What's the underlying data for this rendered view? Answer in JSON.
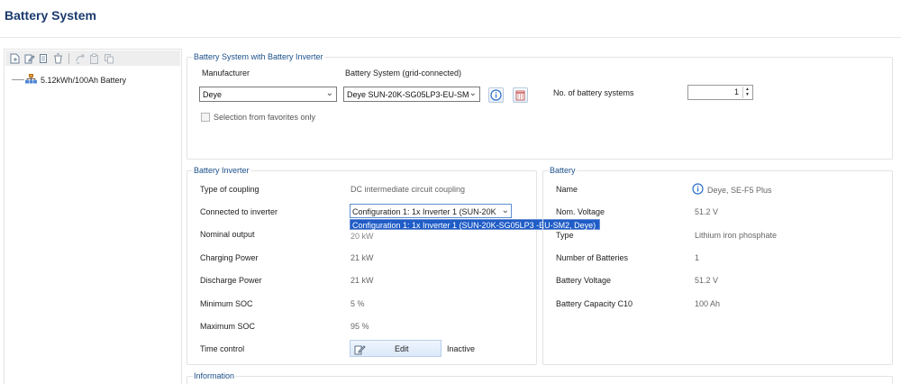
{
  "page": {
    "title": "Battery System"
  },
  "tree": {
    "toolbar_icons": [
      "new-icon",
      "edit-icon",
      "copy-icon",
      "delete-icon",
      "connect-icon",
      "paste-icon",
      "duplicate-icon"
    ],
    "items": [
      {
        "label": "5.12kWh/100Ah Battery",
        "icon": "battery-network-icon"
      }
    ]
  },
  "system_group": {
    "title": "Battery System with Battery Inverter",
    "manufacturer_label": "Manufacturer",
    "manufacturer_value": "Deye",
    "system_label": "Battery System (grid-connected)",
    "system_value": "Deye SUN-20K-SG05LP3-EU-SM2",
    "favorites_label": "Selection from favorites only",
    "count_label": "No. of battery systems",
    "count_value": "1"
  },
  "inverter_group": {
    "title": "Battery Inverter",
    "rows": [
      {
        "label": "Type of coupling",
        "value": "DC intermediate circuit coupling"
      },
      {
        "label": "Connected to inverter",
        "value": "Configuration 1: 1x Inverter 1 (SUN-20K"
      },
      {
        "label": "Nominal output",
        "value": "20 kW"
      },
      {
        "label": "Charging Power",
        "value": "21 kW"
      },
      {
        "label": "Discharge Power",
        "value": "21 kW"
      },
      {
        "label": "Minimum SOC",
        "value": "5 %"
      },
      {
        "label": "Maximum SOC",
        "value": "95 %"
      },
      {
        "label": "Time control",
        "value": "Inactive"
      }
    ],
    "dropdown_option": "Configuration 1: 1x Inverter 1 (SUN-20K-SG05LP3 -EU-SM2, Deye)",
    "edit_label": "Edit"
  },
  "battery_group": {
    "title": "Battery",
    "rows": [
      {
        "label": "Name",
        "value": "Deye, SE-F5 Plus"
      },
      {
        "label": "Nom. Voltage",
        "value": "51.2 V"
      },
      {
        "label": "Type",
        "value": "Lithium iron phosphate"
      },
      {
        "label": "Number of Batteries",
        "value": "1"
      },
      {
        "label": "Battery Voltage",
        "value": "51.2 V"
      },
      {
        "label": "Battery Capacity C10",
        "value": "100 Ah"
      }
    ]
  },
  "info_group": {
    "title": "Information"
  },
  "colors": {
    "title": "#1a3a6e",
    "group_title": "#1a4f8a",
    "selection": "#1f5cc7",
    "info_icon": "#2a6fc9"
  }
}
